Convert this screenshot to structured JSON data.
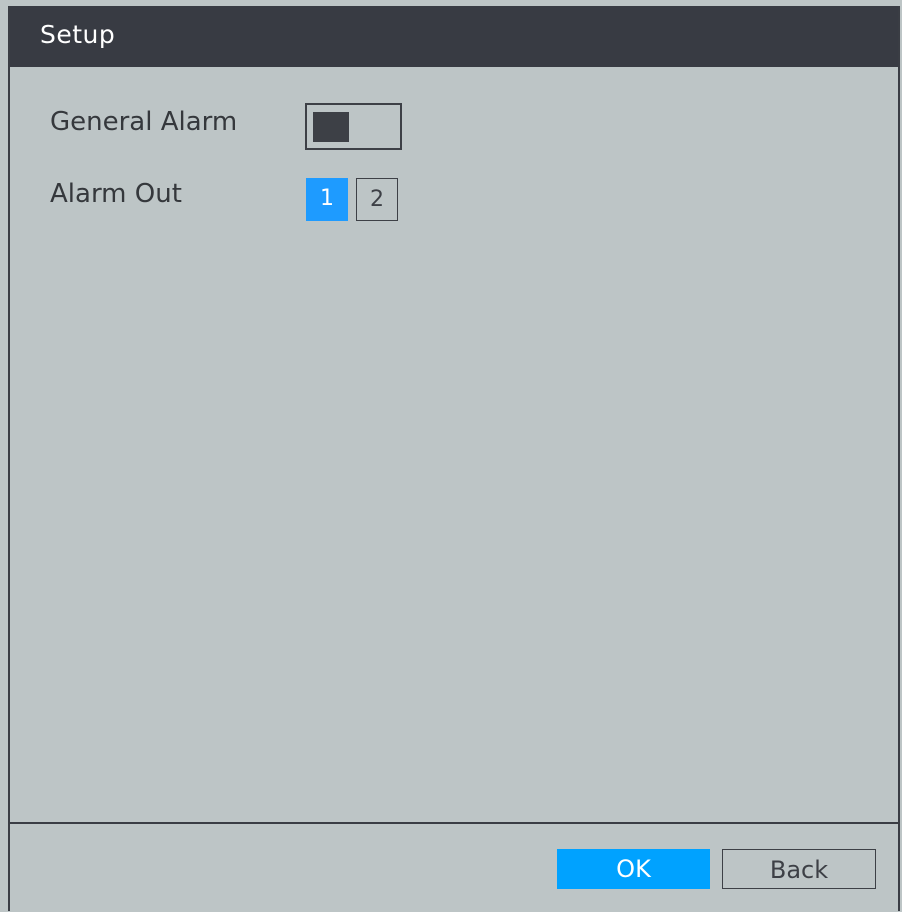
{
  "dialog": {
    "title": "Setup"
  },
  "general_alarm": {
    "label": "General Alarm",
    "enabled": false
  },
  "alarm_out": {
    "label": "Alarm Out",
    "channels": [
      {
        "label": "1",
        "selected": true
      },
      {
        "label": "2",
        "selected": false
      }
    ]
  },
  "footer": {
    "ok_label": "OK",
    "back_label": "Back"
  },
  "colors": {
    "titlebar": "#383b43",
    "background": "#bdc5c6",
    "accent": "#00a2ff",
    "selected_channel": "#1e9bff"
  }
}
